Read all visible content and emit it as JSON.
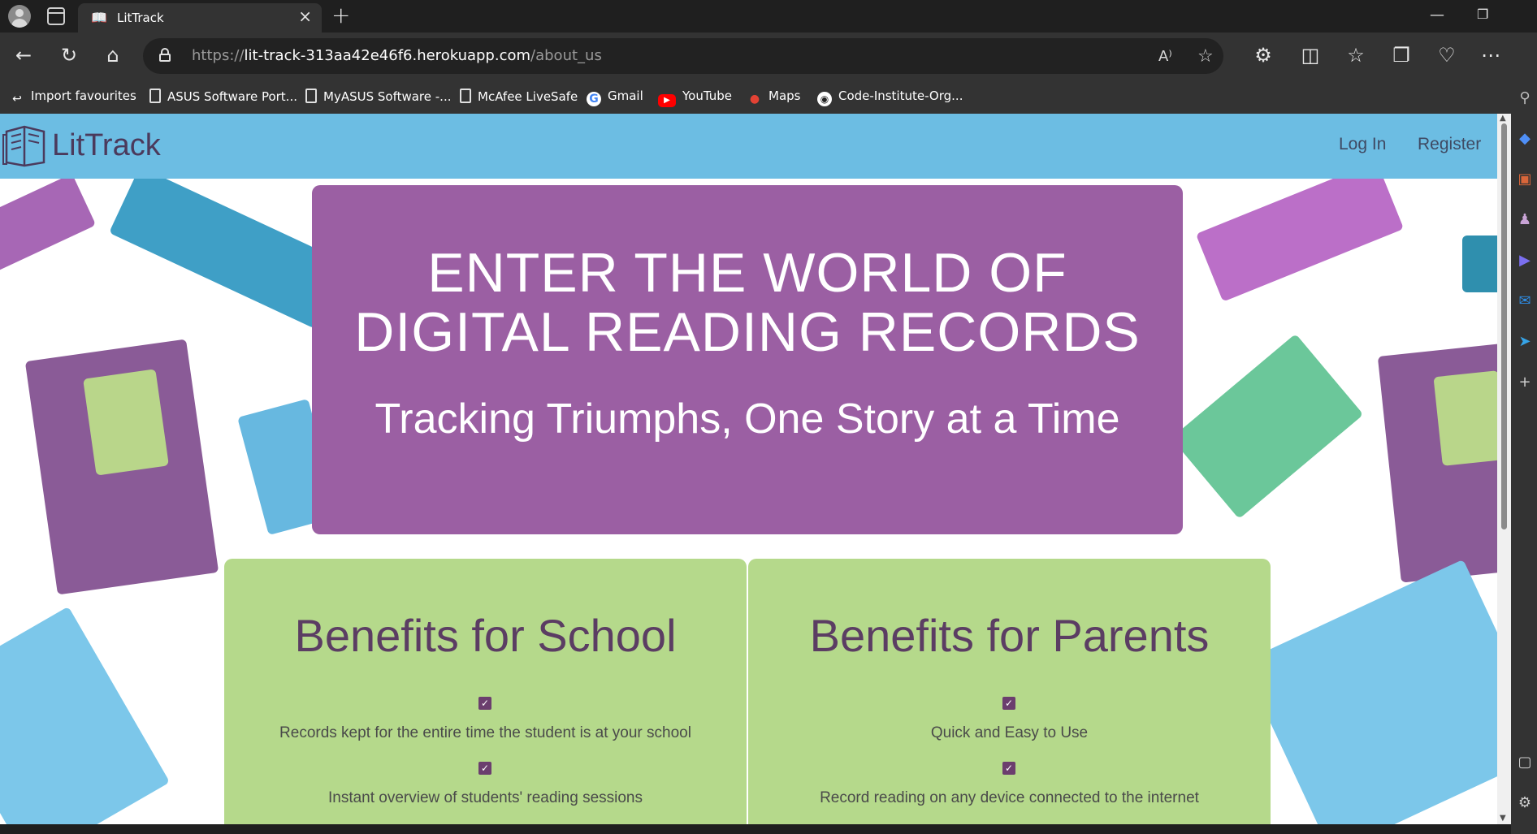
{
  "browser": {
    "tab_title": "LitTrack",
    "url_scheme": "https://",
    "url_host": "lit-track-313aa42e46f6.herokuapp.com",
    "url_path": "/about_us",
    "bookmarks": [
      {
        "label": "Import favourites",
        "icon": "import-icon"
      },
      {
        "label": "ASUS Software Port...",
        "icon": "document-icon"
      },
      {
        "label": "MyASUS Software -...",
        "icon": "document-icon"
      },
      {
        "label": "McAfee LiveSafe",
        "icon": "document-icon"
      },
      {
        "label": "Gmail",
        "icon": "google-icon"
      },
      {
        "label": "YouTube",
        "icon": "youtube-icon"
      },
      {
        "label": "Maps",
        "icon": "maps-icon"
      },
      {
        "label": "Code-Institute-Org...",
        "icon": "github-icon"
      }
    ]
  },
  "site": {
    "brand": "LitTrack",
    "nav": {
      "login": "Log In",
      "register": "Register"
    },
    "hero": {
      "heading": "ENTER THE WORLD OF DIGITAL READING RECORDS",
      "tagline": "Tracking Triumphs, One Story at a Time"
    },
    "benefits": [
      {
        "title": "Benefits for School",
        "items": [
          "Records kept for the entire time the student is at your school",
          "Instant overview of students' reading sessions"
        ]
      },
      {
        "title": "Benefits for Parents",
        "items": [
          "Quick and Easy to Use",
          "Record reading on any device connected to the internet"
        ]
      }
    ]
  },
  "colors": {
    "navbar": "#6cbde3",
    "hero": "#9b5fa3",
    "card": "#b5d98b",
    "checkbox": "#6b3e6e"
  }
}
